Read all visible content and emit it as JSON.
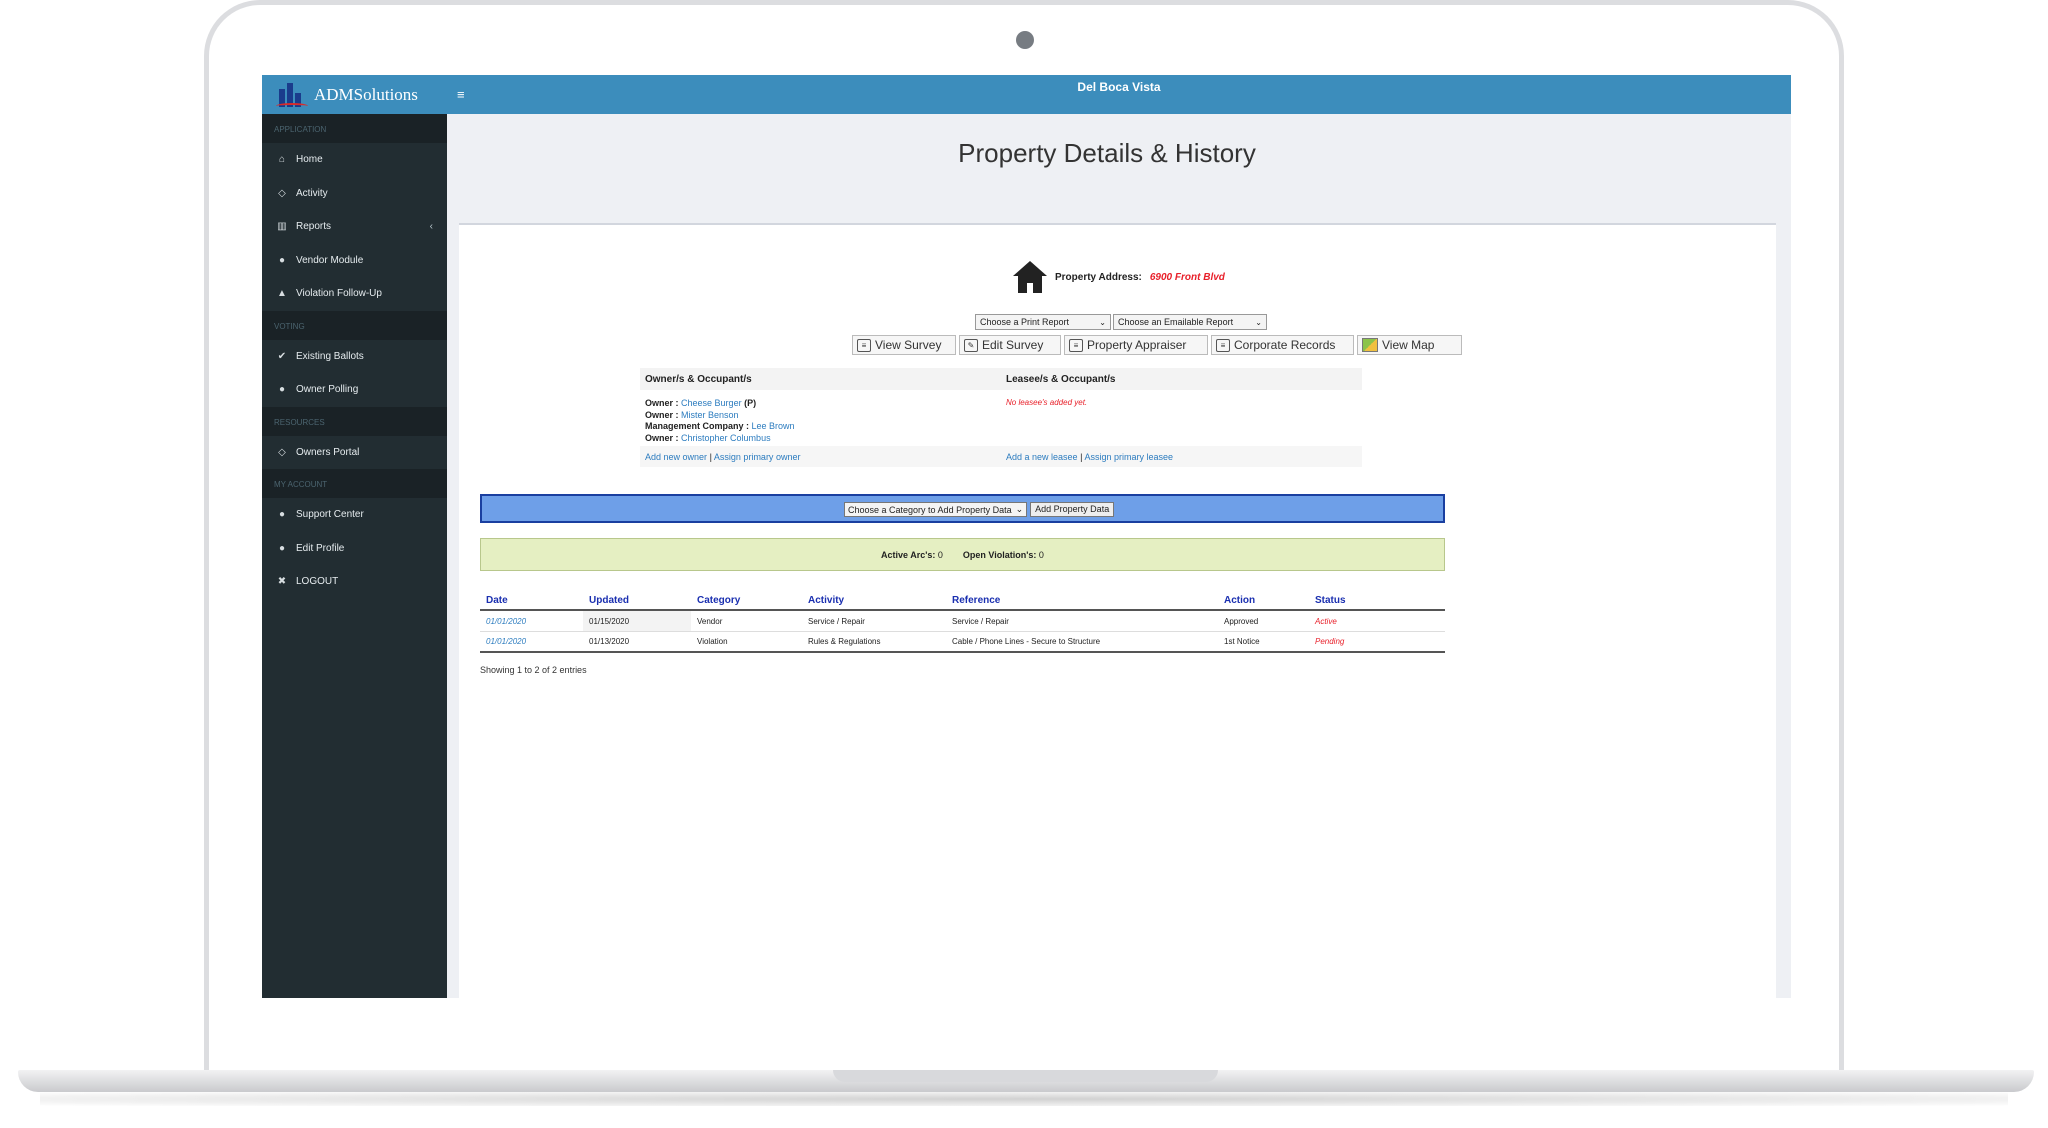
{
  "app": {
    "logo_text": "ADMSolutions",
    "community": "Del Boca Vista",
    "page_title": "Property Details & History"
  },
  "sidebar": {
    "sections": [
      {
        "header": "APPLICATION",
        "items": [
          {
            "label": "Home",
            "icon": "home-icon"
          },
          {
            "label": "Activity",
            "icon": "eye-icon"
          },
          {
            "label": "Reports",
            "icon": "bar-chart-icon"
          },
          {
            "label": "Vendor Module",
            "icon": "user-icon"
          },
          {
            "label": "Violation Follow-Up",
            "icon": "warning-icon"
          }
        ]
      },
      {
        "header": "VOTING",
        "items": [
          {
            "label": "Existing Ballots",
            "icon": "check-icon"
          },
          {
            "label": "Owner Polling",
            "icon": "user-icon"
          }
        ]
      },
      {
        "header": "RESOURCES",
        "items": [
          {
            "label": "Owners Portal",
            "icon": "eye-icon"
          }
        ]
      },
      {
        "header": "MY ACCOUNT",
        "items": [
          {
            "label": "Support Center",
            "icon": "user-icon"
          },
          {
            "label": "Edit Profile",
            "icon": "user-icon"
          },
          {
            "label": "LOGOUT",
            "icon": "close-icon"
          }
        ]
      }
    ]
  },
  "property": {
    "address_label": "Property Address:",
    "address": "6900 Front Blvd",
    "print_report_select": "Choose a Print Report",
    "email_report_select": "Choose an Emailable Report",
    "actions": [
      "View Survey",
      "Edit Survey",
      "Property Appraiser",
      "Corporate Records",
      "View Map"
    ]
  },
  "owners": {
    "owners_header": "Owner/s & Occupant/s",
    "lessees_header": "Leasee/s & Occupant/s",
    "list": [
      {
        "role": "Owner :",
        "name": "Cheese Burger",
        "suffix": "(P)"
      },
      {
        "role": "Owner :",
        "name": "Mister Benson",
        "suffix": ""
      },
      {
        "role": "Management Company :",
        "name": "Lee Brown",
        "suffix": ""
      },
      {
        "role": "Owner :",
        "name": "Christopher Columbus",
        "suffix": ""
      }
    ],
    "no_lessees": "No leasee's added yet.",
    "add_owner": "Add new owner",
    "assign_owner": "Assign primary owner",
    "add_lessee": "Add a new leasee",
    "assign_lessee": "Assign primary leasee",
    "separator": "|"
  },
  "category": {
    "select": "Choose a Category to Add Property Data",
    "button": "Add Property Data"
  },
  "summary": {
    "arcs_label": "Active Arc's:",
    "arcs_value": "0",
    "violations_label": "Open Violation's:",
    "violations_value": "0"
  },
  "history": {
    "columns": [
      "Date",
      "Updated",
      "Category",
      "Activity",
      "Reference",
      "Action",
      "Status"
    ],
    "rows": [
      {
        "date": "01/01/2020",
        "updated": "01/15/2020",
        "category": "Vendor",
        "activity": "Service / Repair",
        "reference": "Service / Repair",
        "action": "Approved",
        "status": "Active"
      },
      {
        "date": "01/01/2020",
        "updated": "01/13/2020",
        "category": "Violation",
        "activity": "Rules & Regulations",
        "reference": "Cable / Phone Lines - Secure to Structure",
        "action": "1st Notice",
        "status": "Pending"
      }
    ],
    "showing": "Showing 1 to 2 of 2 entries"
  }
}
